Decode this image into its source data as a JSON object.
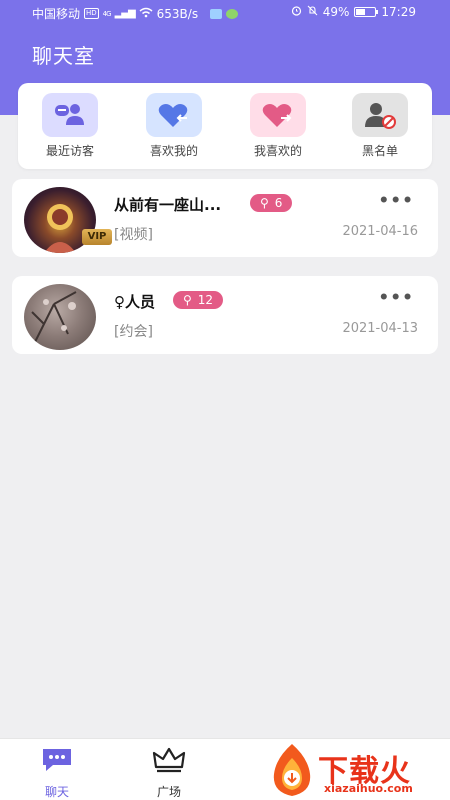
{
  "status_bar": {
    "carrier": "中国移动",
    "hd": "HD",
    "network": "4G",
    "speed": "653B/s",
    "battery_percent": "49%",
    "battery_level": 0.49,
    "time": "17:29"
  },
  "header": {
    "title": "聊天室"
  },
  "quick_actions": [
    {
      "label": "最近访客",
      "icon": "visitor-icon",
      "color": "#dcdcff"
    },
    {
      "label": "喜欢我的",
      "icon": "heart-arrow-in-icon",
      "color": "#d6e4ff"
    },
    {
      "label": "我喜欢的",
      "icon": "heart-arrow-out-icon",
      "color": "#ffdde8"
    },
    {
      "label": "黑名单",
      "icon": "blocked-user-icon",
      "color": "#e3e3e3"
    }
  ],
  "chats": [
    {
      "name": "从前有一座山...",
      "badge": "6",
      "vip_label": "VIP",
      "tag": "[视频]",
      "date": "2021-04-16",
      "more": "•••"
    },
    {
      "name": "♀人员",
      "badge": "12",
      "tag": "[约会]",
      "date": "2021-04-13",
      "more": "•••"
    }
  ],
  "tabbar": {
    "items": [
      {
        "label": "聊天",
        "icon": "chat-icon",
        "active": true
      },
      {
        "label": "广场",
        "icon": "crown-icon",
        "active": false
      }
    ]
  },
  "watermark": {
    "text": "下载火",
    "url": "xiazaihuo.com"
  },
  "colors": {
    "accent": "#7b72ea",
    "badge": "#e35b86",
    "background": "#efeff1"
  }
}
